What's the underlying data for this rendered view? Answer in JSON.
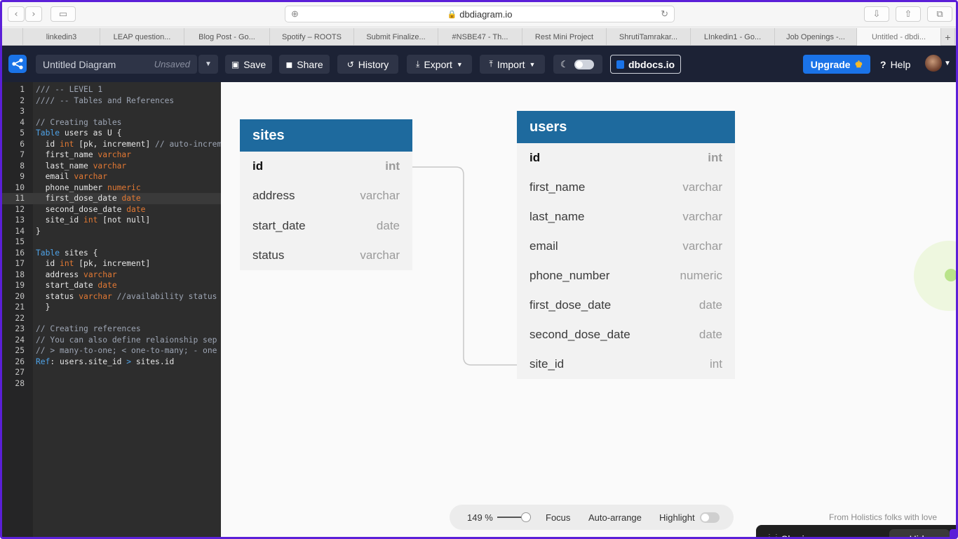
{
  "browser": {
    "url": "dbdiagram.io",
    "tabs": [
      "",
      "linkedin3",
      "LEAP question...",
      "Blog Post - Go...",
      "Spotify – ROOTS",
      "Submit Finalize...",
      "#NSBE47 - Th...",
      "Rest Mini Project",
      "ShrutiTamrakar...",
      "LInkedin1 - Go...",
      "Job Openings -...",
      "Untitled - dbdi..."
    ],
    "new_tab": "+"
  },
  "header": {
    "title": "Untitled Diagram",
    "status": "Unsaved",
    "save": "Save",
    "share": "Share",
    "history": "History",
    "export": "Export",
    "import": "Import",
    "dbdocs": "dbdocs.io",
    "upgrade": "Upgrade",
    "help": "Help"
  },
  "editor": {
    "line_numbers": [
      "1",
      "2",
      "3",
      "4",
      "5",
      "6",
      "7",
      "8",
      "9",
      "10",
      "11",
      "12",
      "13",
      "14",
      "15",
      "16",
      "17",
      "18",
      "19",
      "20",
      "21",
      "22",
      "23",
      "24",
      "25",
      "26",
      "27",
      "28"
    ],
    "code_lines": [
      "/// -- LEVEL 1",
      "//// -- Tables and References",
      "",
      "// Creating tables",
      "Table users as U {",
      "  id int [pk, increment] // auto-increment",
      "  first_name varchar",
      "  last_name varchar",
      "  email varchar",
      "  phone_number numeric",
      "  first_dose_date date",
      "  second_dose_date date",
      "  site_id int [not null]",
      "}",
      "",
      "Table sites {",
      "  id int [pk, increment]",
      "  address varchar",
      "  start_date date",
      "  status varchar //availability status",
      "  }",
      "",
      "// Creating references",
      "// You can also define relaionship sep",
      "// > many-to-one; < one-to-many; - one",
      "Ref: users.site_id > sites.id",
      "",
      ""
    ]
  },
  "tables": {
    "sites": {
      "name": "sites",
      "columns": [
        {
          "name": "id",
          "type": "int"
        },
        {
          "name": "address",
          "type": "varchar"
        },
        {
          "name": "start_date",
          "type": "date"
        },
        {
          "name": "status",
          "type": "varchar"
        }
      ]
    },
    "users": {
      "name": "users",
      "columns": [
        {
          "name": "id",
          "type": "int"
        },
        {
          "name": "first_name",
          "type": "varchar"
        },
        {
          "name": "last_name",
          "type": "varchar"
        },
        {
          "name": "email",
          "type": "varchar"
        },
        {
          "name": "phone_number",
          "type": "numeric"
        },
        {
          "name": "first_dose_date",
          "type": "date"
        },
        {
          "name": "second_dose_date",
          "type": "date"
        },
        {
          "name": "site_id",
          "type": "int"
        }
      ]
    }
  },
  "toolbar": {
    "zoom": "149 %",
    "focus": "Focus",
    "auto_arrange": "Auto-arrange",
    "highlight": "Highlight"
  },
  "footer": {
    "credit": "From Holistics folks with love",
    "sharing": "Sharing your screen",
    "hide": "Hide"
  },
  "colors": {
    "table_header": "#1e6a9e",
    "app_header": "#1c2235",
    "accent": "#1a73e8",
    "window_border": "#5b1fd8"
  }
}
